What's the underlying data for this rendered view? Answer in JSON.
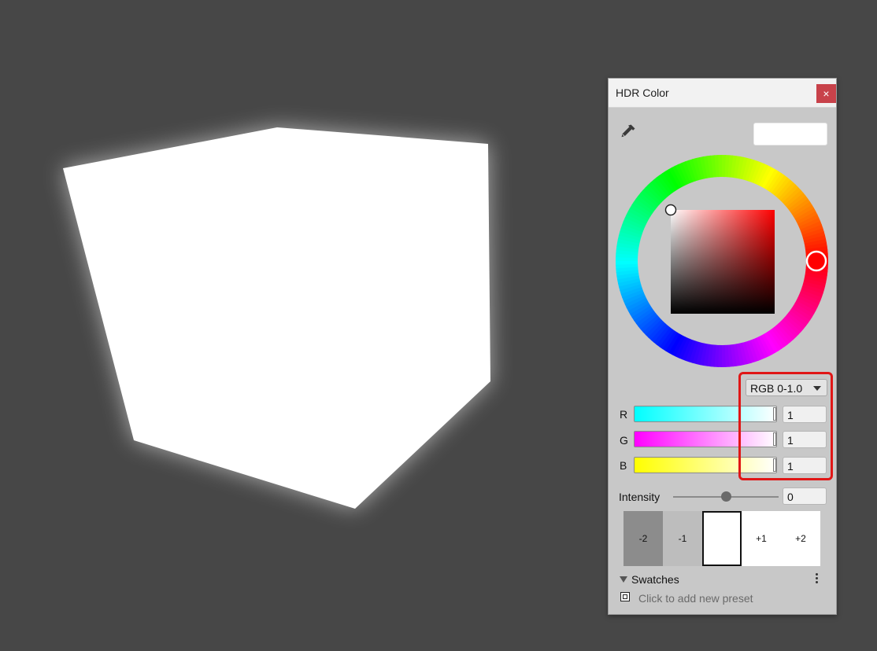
{
  "window": {
    "title": "HDR Color",
    "close_glyph": "×"
  },
  "icons": {
    "eyedropper": "eyedropper-icon",
    "close": "close-icon",
    "kebab": "kebab-menu-icon",
    "triangle": "collapse-triangle-icon"
  },
  "colors": {
    "scene_bg": "#474747",
    "cube": "#ffffff",
    "panel_bg": "#c8c8c8",
    "current_color": "#ffffff",
    "hue_handle": "#ff0000",
    "highlight": "#e01616",
    "close_button": "#c8424a"
  },
  "color_mode": {
    "selected": "RGB 0-1.0"
  },
  "channels": [
    {
      "label": "R",
      "value": "1",
      "fraction": 1.0,
      "from": "#00ffff",
      "to": "#ffffff"
    },
    {
      "label": "G",
      "value": "1",
      "fraction": 1.0,
      "from": "#ff00ff",
      "to": "#ffffff"
    },
    {
      "label": "B",
      "value": "1",
      "fraction": 1.0,
      "from": "#ffff00",
      "to": "#ffffff"
    }
  ],
  "intensity": {
    "label": "Intensity",
    "value": "0",
    "fraction": 0.5
  },
  "exposure_stops": [
    {
      "label": "-2",
      "bg": "#8c8c8c"
    },
    {
      "label": "-1",
      "bg": "#bdbdbd"
    },
    {
      "label": "",
      "bg": "#ffffff",
      "selected": true
    },
    {
      "label": "+1",
      "bg": "#ffffff"
    },
    {
      "label": "+2",
      "bg": "#ffffff"
    }
  ],
  "swatches": {
    "title": "Swatches",
    "add_preset": "Click to add new preset"
  }
}
